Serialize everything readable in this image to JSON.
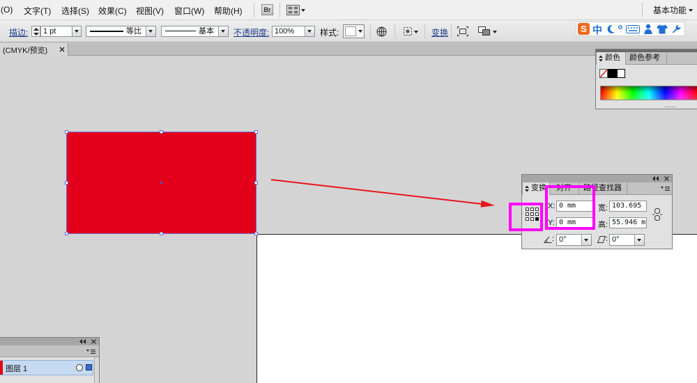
{
  "window": {
    "menu": [
      "(O)",
      "文字(T)",
      "选择(S)",
      "效果(C)",
      "视图(V)",
      "窗口(W)",
      "帮助(H)"
    ],
    "bridge_label": "Br",
    "workspace": "基本功能"
  },
  "control_bar": {
    "stroke_label": "描边:",
    "stroke_weight": "1 pt",
    "stroke_profile": "等比",
    "brush": "基本",
    "opacity_label": "不透明度:",
    "opacity": "100%",
    "style_label": "样式:",
    "transform_link": "变换"
  },
  "ime_toolbar": {
    "logo": "S",
    "mode": "中"
  },
  "document_tab": {
    "title": "(CMYK/预览)"
  },
  "color_panel": {
    "tabs": [
      "颜色",
      "颜色参考"
    ]
  },
  "transform_panel": {
    "tabs": [
      "变换",
      "对齐",
      "路径查找器"
    ],
    "x": {
      "label": "X:",
      "value": "0 mm"
    },
    "y": {
      "label": "Y:",
      "value": "0 mm"
    },
    "width": {
      "label": "宽:",
      "value": "103.695"
    },
    "height": {
      "label": "高:",
      "value": "55.946 m"
    },
    "rotate": {
      "label": ":",
      "value": "0°"
    },
    "shear": {
      "label": ":",
      "value": "0°"
    }
  },
  "layers_panel": {
    "layers": [
      {
        "name": "图层 1"
      }
    ]
  },
  "colors": {
    "object_fill": "#e3001b",
    "highlight": "#ff00ff",
    "arrow": "#e8141c",
    "selection_outline": "#6c6cd8",
    "link_text": "#1e3c8c",
    "layer_color": "#e30613"
  },
  "icons": [
    "bridge-icon",
    "arrange-documents-icon",
    "stepper-icon",
    "recolor-globe-icon",
    "select-similar-icon",
    "isolate-icon",
    "arrange-icon",
    "sogou-moon-icon",
    "keyboard-icon",
    "skin-icon",
    "wrench-icon",
    "collapse-icon",
    "close-icon",
    "panel-menu-icon",
    "reference-point-icon",
    "constrain-link-icon",
    "rotate-icon",
    "shear-icon",
    "none-swatch-icon"
  ]
}
